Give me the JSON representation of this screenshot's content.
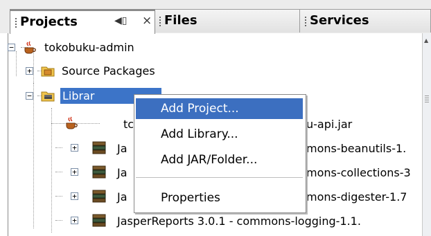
{
  "tabs": [
    {
      "label": "Projects"
    },
    {
      "label": "Files"
    },
    {
      "label": "Services"
    }
  ],
  "tab_controls": {
    "minimize": "◀▯",
    "close": "×"
  },
  "tree": {
    "root": "tokobuku-admin",
    "source_packages": "Source Packages",
    "libraries": "Libraries",
    "libraries_visible": "Librar",
    "items": [
      {
        "prefix": "tc",
        "suffix": "u-api.jar"
      },
      {
        "prefix": "Ja",
        "suffix": "mons-beanutils-1."
      },
      {
        "prefix": "Ja",
        "suffix": "mons-collections-3"
      },
      {
        "prefix": "Ja",
        "suffix": "mons-digester-1.7"
      },
      {
        "full": "JasperReports 3.0.1 - commons-logging-1.1."
      }
    ]
  },
  "context_menu": {
    "items": [
      "Add Project...",
      "Add Library...",
      "Add JAR/Folder...",
      "Properties"
    ]
  }
}
